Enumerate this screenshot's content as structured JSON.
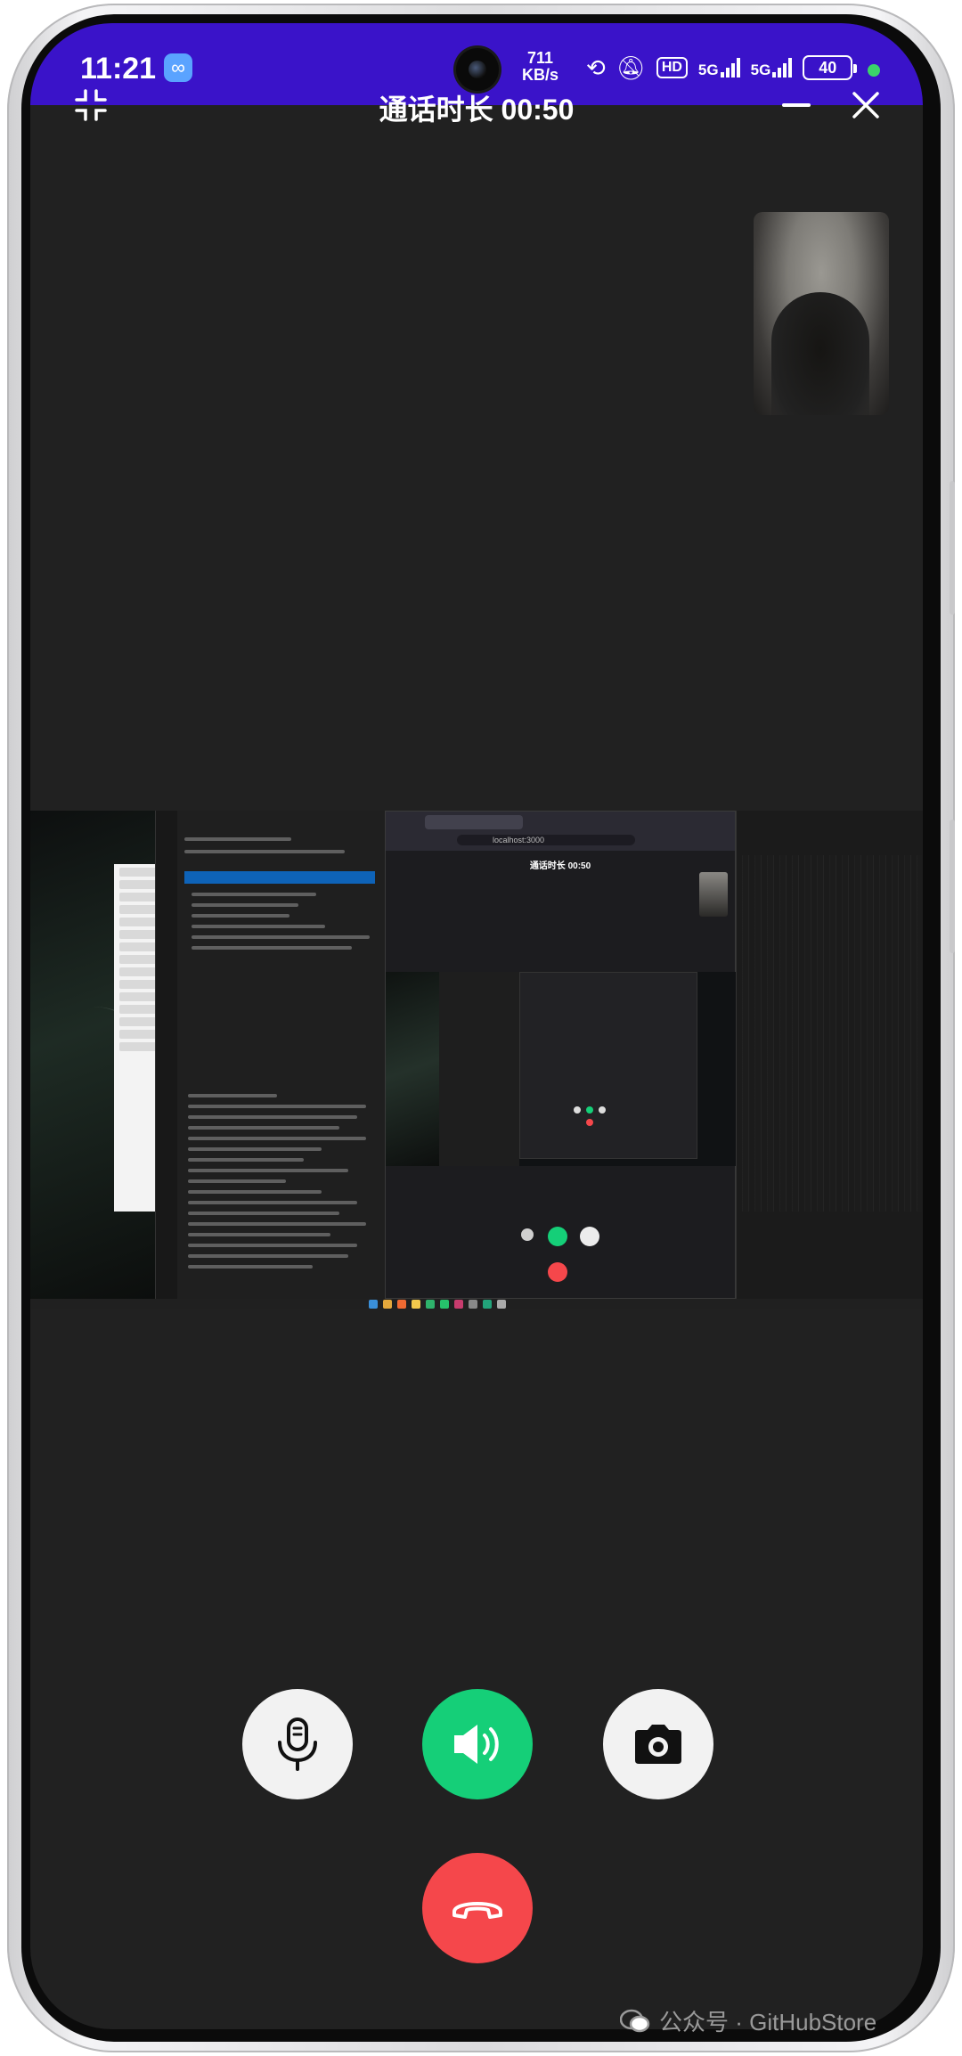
{
  "status_bar": {
    "time": "11:21",
    "net_speed_value": "711",
    "net_speed_unit": "KB/s",
    "hd_label": "HD",
    "sim1_label": "5G",
    "sim2_label": "5G",
    "battery_level": "40"
  },
  "call": {
    "title": "通话时长 00:50"
  },
  "shared_screen": {
    "inner_call_title": "通话时长 00:50",
    "url": "localhost:3000"
  },
  "controls": {
    "mic": "mic-icon",
    "speaker": "speaker-icon",
    "camera": "camera-icon",
    "hangup": "hangup-icon",
    "speaker_active_color": "#15cf78",
    "hangup_color": "#f5474b"
  },
  "watermark": {
    "text": "公众号 · GitHubStore"
  },
  "theme": {
    "status_bar_bg": "#3a13c9",
    "call_bg": "#212121"
  }
}
